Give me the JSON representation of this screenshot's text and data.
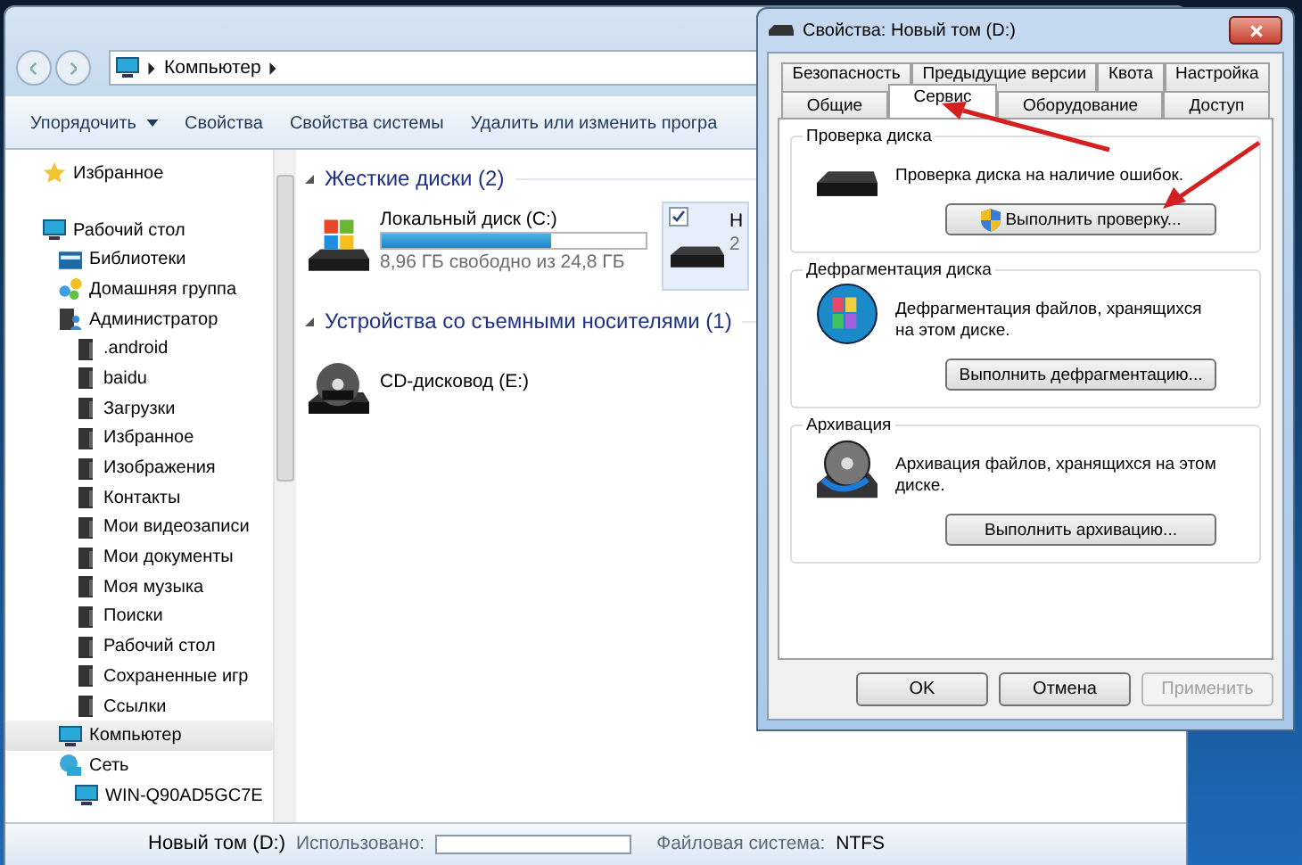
{
  "explorer": {
    "address": {
      "path": [
        "Компьютер"
      ]
    },
    "toolbar": [
      {
        "label": "Упорядочить",
        "kind": "menu"
      },
      {
        "label": "Свойства",
        "kind": "button"
      },
      {
        "label": "Свойства системы",
        "kind": "button"
      },
      {
        "label": "Удалить или изменить програ",
        "kind": "button"
      }
    ],
    "sidebar": {
      "items": [
        {
          "label": "Избранное",
          "kind": "favorites",
          "selected": false
        },
        {
          "label": "Рабочий стол",
          "kind": "desktop",
          "selected": false,
          "children": [
            {
              "label": "Библиотеки",
              "kind": "libraries",
              "selected": false
            },
            {
              "label": "Домашняя группа",
              "kind": "homegroup",
              "selected": false
            },
            {
              "label": "Администратор",
              "kind": "user",
              "selected": false,
              "children": [
                {
                  "label": ".android",
                  "kind": "folder",
                  "selected": false
                },
                {
                  "label": "baidu",
                  "kind": "folder",
                  "selected": false
                },
                {
                  "label": "Загрузки",
                  "kind": "folder",
                  "selected": false
                },
                {
                  "label": "Избранное",
                  "kind": "folder",
                  "selected": false
                },
                {
                  "label": "Изображения",
                  "kind": "folder",
                  "selected": false
                },
                {
                  "label": "Контакты",
                  "kind": "folder",
                  "selected": false
                },
                {
                  "label": "Мои видеозаписи",
                  "kind": "folder",
                  "selected": false
                },
                {
                  "label": "Мои документы",
                  "kind": "folder",
                  "selected": false
                },
                {
                  "label": "Моя музыка",
                  "kind": "folder",
                  "selected": false
                },
                {
                  "label": "Поиски",
                  "kind": "folder",
                  "selected": false
                },
                {
                  "label": "Рабочий стол",
                  "kind": "folder",
                  "selected": false
                },
                {
                  "label": "Сохраненные игр",
                  "kind": "folder",
                  "selected": false
                },
                {
                  "label": "Ссылки",
                  "kind": "folder",
                  "selected": false
                }
              ]
            },
            {
              "label": "Компьютер",
              "kind": "computer",
              "selected": true
            },
            {
              "label": "Сеть",
              "kind": "network",
              "selected": false,
              "children": [
                {
                  "label": "WIN-Q90AD5GC7E",
                  "kind": "computer",
                  "selected": false
                }
              ]
            }
          ]
        }
      ]
    },
    "groups": [
      {
        "title": "Жесткие диски (2)",
        "expanded": true,
        "items": [
          {
            "name": "Локальный диск (C:)",
            "detail": "8,96 ГБ свободно из 24,8 ГБ",
            "level": 0.64,
            "kind": "windows-drive",
            "selected": false,
            "checked": false
          },
          {
            "name": "Н",
            "detail": "2",
            "kind": "drive",
            "selected": true,
            "checked": true
          }
        ]
      },
      {
        "title": "Устройства со съемными носителями (1)",
        "expanded": true,
        "items": [
          {
            "name": "CD-дисковод (E:)",
            "kind": "dvd",
            "selected": false,
            "checked": false
          }
        ]
      }
    ],
    "details_pane": {
      "name": "Новый том (D:)",
      "used_label": "Использовано:",
      "used_bar": {
        "level": 0
      },
      "fs_label": "Файловая система:",
      "fs_value": "NTFS"
    }
  },
  "dialog": {
    "title": "Свойства: Новый том (D:)",
    "tab_rows": [
      [
        {
          "label": "Безопасность",
          "selected": false
        },
        {
          "label": "Предыдущие версии",
          "selected": false
        },
        {
          "label": "Квота",
          "selected": false
        },
        {
          "label": "Настройка",
          "selected": false
        }
      ],
      [
        {
          "label": "Общие",
          "selected": false
        },
        {
          "label": "Сервис",
          "selected": true
        },
        {
          "label": "Оборудование",
          "selected": false
        },
        {
          "label": "Доступ",
          "selected": false
        }
      ]
    ],
    "sections": [
      {
        "title": "Проверка диска",
        "text": "Проверка диска на наличие ошибок.",
        "button": "Выполнить проверку...",
        "kind": "check"
      },
      {
        "title": "Дефрагментация диска",
        "text": "Дефрагментация файлов, хранящихся на этом диске.",
        "button": "Выполнить дефрагментацию...",
        "kind": "defrag"
      },
      {
        "title": "Архивация",
        "text": "Архивация файлов, хранящихся на этом диске.",
        "button": "Выполнить архивацию...",
        "kind": "backup"
      }
    ],
    "buttons": [
      {
        "label": "OK",
        "disabled": false
      },
      {
        "label": "Отмена",
        "disabled": false
      },
      {
        "label": "Применить",
        "disabled": true
      }
    ]
  }
}
